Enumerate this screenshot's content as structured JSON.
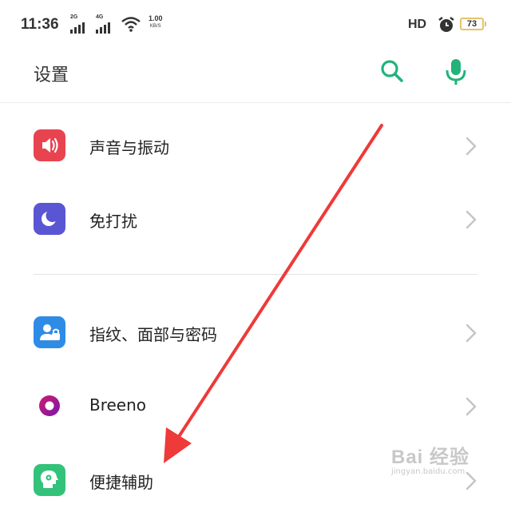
{
  "status_bar": {
    "time": "11:36",
    "sim1_gen": "2G",
    "sim2_gen": "4G",
    "net_speed_value": "1.00",
    "net_speed_unit": "KB/S",
    "hd_label": "HD",
    "battery_level": "73"
  },
  "header": {
    "title": "设置"
  },
  "settings": {
    "items": [
      {
        "label": "声音与振动",
        "icon": "speaker-icon",
        "color": "#e84450"
      },
      {
        "label": "免打扰",
        "icon": "moon-icon",
        "color": "#5a55d2"
      },
      {
        "label": "指纹、面部与密码",
        "icon": "fingerprint-user-icon",
        "color": "#2f8ce6"
      },
      {
        "label": "Breeno",
        "icon": "breeno-ring-icon",
        "color": "#a0148c"
      },
      {
        "label": "便捷辅助",
        "icon": "head-assist-icon",
        "color": "#33c27a"
      }
    ]
  },
  "watermark": {
    "brand": "Bai 经验",
    "site": "jingyan.baidu.com"
  },
  "colors": {
    "accent": "#22b37a",
    "annotation_arrow": "#ee3a38"
  }
}
